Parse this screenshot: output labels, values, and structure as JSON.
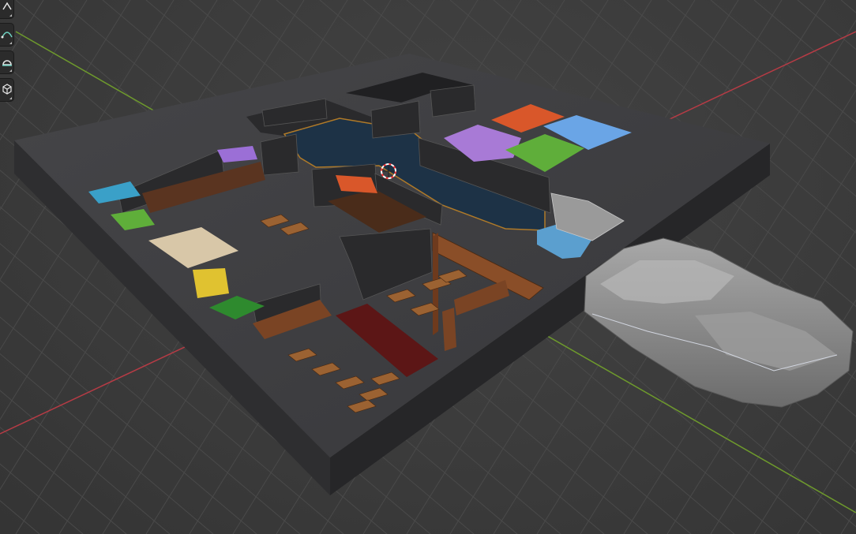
{
  "viewport": {
    "background_color": "#3b3b3b",
    "grid_line_color": "#4a4a4a",
    "x_axis_color": "#b63b45",
    "y_axis_color": "#6e9a2c"
  },
  "scene": {
    "base_top_color": "#3f3f42",
    "base_side_color": "#2c2c2e",
    "floor_color": "#3d3d40",
    "water_color": "#1d3246",
    "rug_color": "#5c1616",
    "wood_color": "#8a4e28",
    "stone_wall_color": "#252527",
    "rock_color": "#8a8a8a",
    "canopy_colors": [
      "#3aa0c8",
      "#9b6fd6",
      "#5fae3a",
      "#d8c7a8",
      "#e0c230",
      "#2e8a2e",
      "#d9572a",
      "#5a9de0"
    ]
  },
  "toolbar": {
    "items": [
      {
        "icon": "transform-icon"
      },
      {
        "icon": "curve-icon"
      },
      {
        "icon": "annotate-icon"
      },
      {
        "icon": "add-cube-icon"
      }
    ]
  }
}
